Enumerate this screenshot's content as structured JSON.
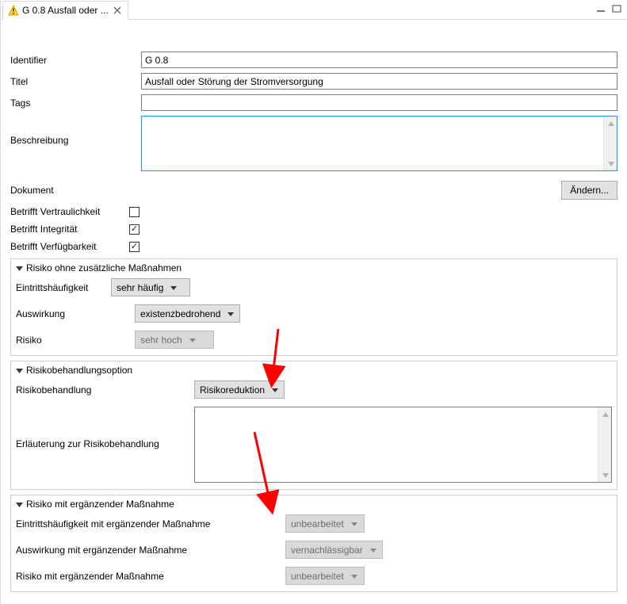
{
  "tab": {
    "title": "G 0.8 Ausfall oder ..."
  },
  "fields": {
    "identifier_label": "Identifier",
    "identifier_value": "G 0.8",
    "title_label": "Titel",
    "title_value": "Ausfall oder Störung der Stromversorgung",
    "tags_label": "Tags",
    "tags_value": "",
    "description_label": "Beschreibung",
    "description_value": "",
    "document_label": "Dokument",
    "change_button": "Ändern..."
  },
  "affects": {
    "confidentiality_label": "Betrifft Vertraulichkeit",
    "confidentiality_checked": false,
    "integrity_label": "Betrifft Integrität",
    "integrity_checked": true,
    "availability_label": "Betrifft Verfügbarkeit",
    "availability_checked": true
  },
  "section1": {
    "header": "Risiko ohne zusätzliche Maßnahmen",
    "frequency_label": "Eintrittshäufigkeit",
    "frequency_value": "sehr häufig",
    "impact_label": "Auswirkung",
    "impact_value": "existenzbedrohend",
    "risk_label": "Risiko",
    "risk_value": "sehr hoch"
  },
  "section2": {
    "header": "Risikobehandlungsoption",
    "treatment_label": "Risikobehandlung",
    "treatment_value": "Risikoreduktion",
    "explanation_label": "Erläuterung zur Risikobehandlung",
    "explanation_value": ""
  },
  "section3": {
    "header": "Risiko mit ergänzender Maßnahme",
    "frequency_label": "Eintrittshäufigkeit mit ergänzender Maßnahme",
    "frequency_value": "unbearbeitet",
    "impact_label": "Auswirkung mit ergänzender Maßnahme",
    "impact_value": "vernachlässigbar",
    "risk_label": "Risiko mit ergänzender Maßnahme",
    "risk_value": "unbearbeitet"
  }
}
